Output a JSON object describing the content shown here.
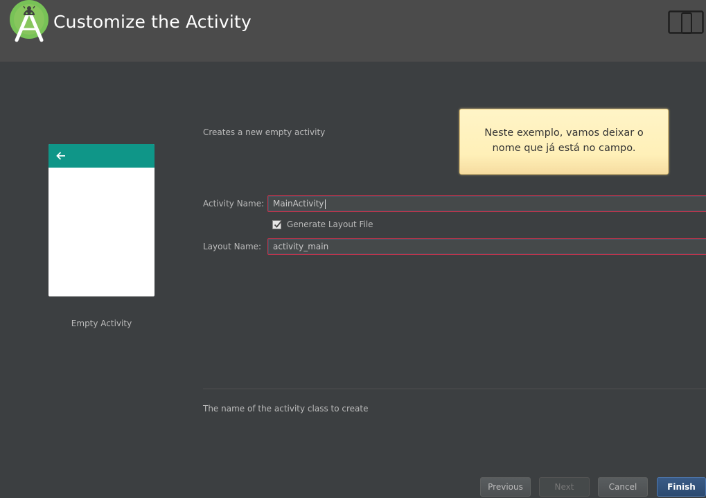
{
  "header": {
    "title": "Customize the Activity",
    "logo_icon": "android-studio-logo-icon",
    "device_icon": "phone-tablet-icon",
    "background": "#4b4b4b"
  },
  "template": {
    "name": "Empty Activity",
    "accent": "#0f9688",
    "back_icon": "back-arrow-icon"
  },
  "description": "Creates a new empty activity",
  "tooltip": {
    "line1": "Neste exemplo, vamos deixar o",
    "line2": "nome que já está no campo."
  },
  "form": {
    "activity_name_label": "Activity Name:",
    "activity_name_value": "MainActivity",
    "generate_layout_label": "Generate Layout File",
    "generate_layout_checked": true,
    "layout_name_label": "Layout Name:",
    "layout_name_value": "activity_main"
  },
  "help_text": "The name of the activity class to create",
  "buttons": {
    "previous": "Previous",
    "next": "Next",
    "cancel": "Cancel",
    "finish": "Finish"
  }
}
